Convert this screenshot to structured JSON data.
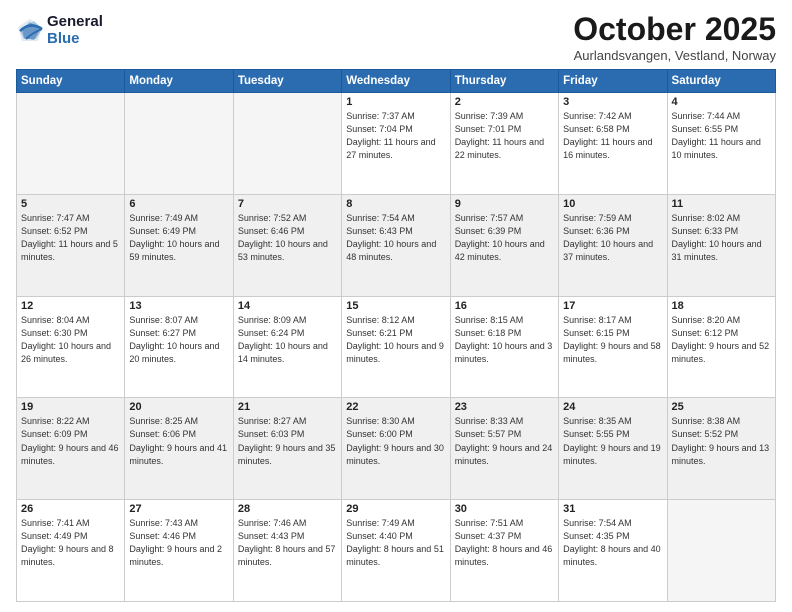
{
  "logo": {
    "general": "General",
    "blue": "Blue"
  },
  "title": "October 2025",
  "location": "Aurlandsvangen, Vestland, Norway",
  "days_of_week": [
    "Sunday",
    "Monday",
    "Tuesday",
    "Wednesday",
    "Thursday",
    "Friday",
    "Saturday"
  ],
  "weeks": [
    [
      {
        "day": "",
        "sunrise": "",
        "sunset": "",
        "daylight": "",
        "empty": true
      },
      {
        "day": "",
        "sunrise": "",
        "sunset": "",
        "daylight": "",
        "empty": true
      },
      {
        "day": "",
        "sunrise": "",
        "sunset": "",
        "daylight": "",
        "empty": true
      },
      {
        "day": "1",
        "sunrise": "Sunrise: 7:37 AM",
        "sunset": "Sunset: 7:04 PM",
        "daylight": "Daylight: 11 hours and 27 minutes."
      },
      {
        "day": "2",
        "sunrise": "Sunrise: 7:39 AM",
        "sunset": "Sunset: 7:01 PM",
        "daylight": "Daylight: 11 hours and 22 minutes."
      },
      {
        "day": "3",
        "sunrise": "Sunrise: 7:42 AM",
        "sunset": "Sunset: 6:58 PM",
        "daylight": "Daylight: 11 hours and 16 minutes."
      },
      {
        "day": "4",
        "sunrise": "Sunrise: 7:44 AM",
        "sunset": "Sunset: 6:55 PM",
        "daylight": "Daylight: 11 hours and 10 minutes."
      }
    ],
    [
      {
        "day": "5",
        "sunrise": "Sunrise: 7:47 AM",
        "sunset": "Sunset: 6:52 PM",
        "daylight": "Daylight: 11 hours and 5 minutes."
      },
      {
        "day": "6",
        "sunrise": "Sunrise: 7:49 AM",
        "sunset": "Sunset: 6:49 PM",
        "daylight": "Daylight: 10 hours and 59 minutes."
      },
      {
        "day": "7",
        "sunrise": "Sunrise: 7:52 AM",
        "sunset": "Sunset: 6:46 PM",
        "daylight": "Daylight: 10 hours and 53 minutes."
      },
      {
        "day": "8",
        "sunrise": "Sunrise: 7:54 AM",
        "sunset": "Sunset: 6:43 PM",
        "daylight": "Daylight: 10 hours and 48 minutes."
      },
      {
        "day": "9",
        "sunrise": "Sunrise: 7:57 AM",
        "sunset": "Sunset: 6:39 PM",
        "daylight": "Daylight: 10 hours and 42 minutes."
      },
      {
        "day": "10",
        "sunrise": "Sunrise: 7:59 AM",
        "sunset": "Sunset: 6:36 PM",
        "daylight": "Daylight: 10 hours and 37 minutes."
      },
      {
        "day": "11",
        "sunrise": "Sunrise: 8:02 AM",
        "sunset": "Sunset: 6:33 PM",
        "daylight": "Daylight: 10 hours and 31 minutes."
      }
    ],
    [
      {
        "day": "12",
        "sunrise": "Sunrise: 8:04 AM",
        "sunset": "Sunset: 6:30 PM",
        "daylight": "Daylight: 10 hours and 26 minutes."
      },
      {
        "day": "13",
        "sunrise": "Sunrise: 8:07 AM",
        "sunset": "Sunset: 6:27 PM",
        "daylight": "Daylight: 10 hours and 20 minutes."
      },
      {
        "day": "14",
        "sunrise": "Sunrise: 8:09 AM",
        "sunset": "Sunset: 6:24 PM",
        "daylight": "Daylight: 10 hours and 14 minutes."
      },
      {
        "day": "15",
        "sunrise": "Sunrise: 8:12 AM",
        "sunset": "Sunset: 6:21 PM",
        "daylight": "Daylight: 10 hours and 9 minutes."
      },
      {
        "day": "16",
        "sunrise": "Sunrise: 8:15 AM",
        "sunset": "Sunset: 6:18 PM",
        "daylight": "Daylight: 10 hours and 3 minutes."
      },
      {
        "day": "17",
        "sunrise": "Sunrise: 8:17 AM",
        "sunset": "Sunset: 6:15 PM",
        "daylight": "Daylight: 9 hours and 58 minutes."
      },
      {
        "day": "18",
        "sunrise": "Sunrise: 8:20 AM",
        "sunset": "Sunset: 6:12 PM",
        "daylight": "Daylight: 9 hours and 52 minutes."
      }
    ],
    [
      {
        "day": "19",
        "sunrise": "Sunrise: 8:22 AM",
        "sunset": "Sunset: 6:09 PM",
        "daylight": "Daylight: 9 hours and 46 minutes."
      },
      {
        "day": "20",
        "sunrise": "Sunrise: 8:25 AM",
        "sunset": "Sunset: 6:06 PM",
        "daylight": "Daylight: 9 hours and 41 minutes."
      },
      {
        "day": "21",
        "sunrise": "Sunrise: 8:27 AM",
        "sunset": "Sunset: 6:03 PM",
        "daylight": "Daylight: 9 hours and 35 minutes."
      },
      {
        "day": "22",
        "sunrise": "Sunrise: 8:30 AM",
        "sunset": "Sunset: 6:00 PM",
        "daylight": "Daylight: 9 hours and 30 minutes."
      },
      {
        "day": "23",
        "sunrise": "Sunrise: 8:33 AM",
        "sunset": "Sunset: 5:57 PM",
        "daylight": "Daylight: 9 hours and 24 minutes."
      },
      {
        "day": "24",
        "sunrise": "Sunrise: 8:35 AM",
        "sunset": "Sunset: 5:55 PM",
        "daylight": "Daylight: 9 hours and 19 minutes."
      },
      {
        "day": "25",
        "sunrise": "Sunrise: 8:38 AM",
        "sunset": "Sunset: 5:52 PM",
        "daylight": "Daylight: 9 hours and 13 minutes."
      }
    ],
    [
      {
        "day": "26",
        "sunrise": "Sunrise: 7:41 AM",
        "sunset": "Sunset: 4:49 PM",
        "daylight": "Daylight: 9 hours and 8 minutes."
      },
      {
        "day": "27",
        "sunrise": "Sunrise: 7:43 AM",
        "sunset": "Sunset: 4:46 PM",
        "daylight": "Daylight: 9 hours and 2 minutes."
      },
      {
        "day": "28",
        "sunrise": "Sunrise: 7:46 AM",
        "sunset": "Sunset: 4:43 PM",
        "daylight": "Daylight: 8 hours and 57 minutes."
      },
      {
        "day": "29",
        "sunrise": "Sunrise: 7:49 AM",
        "sunset": "Sunset: 4:40 PM",
        "daylight": "Daylight: 8 hours and 51 minutes."
      },
      {
        "day": "30",
        "sunrise": "Sunrise: 7:51 AM",
        "sunset": "Sunset: 4:37 PM",
        "daylight": "Daylight: 8 hours and 46 minutes."
      },
      {
        "day": "31",
        "sunrise": "Sunrise: 7:54 AM",
        "sunset": "Sunset: 4:35 PM",
        "daylight": "Daylight: 8 hours and 40 minutes."
      },
      {
        "day": "",
        "sunrise": "",
        "sunset": "",
        "daylight": "",
        "empty": true
      }
    ]
  ]
}
